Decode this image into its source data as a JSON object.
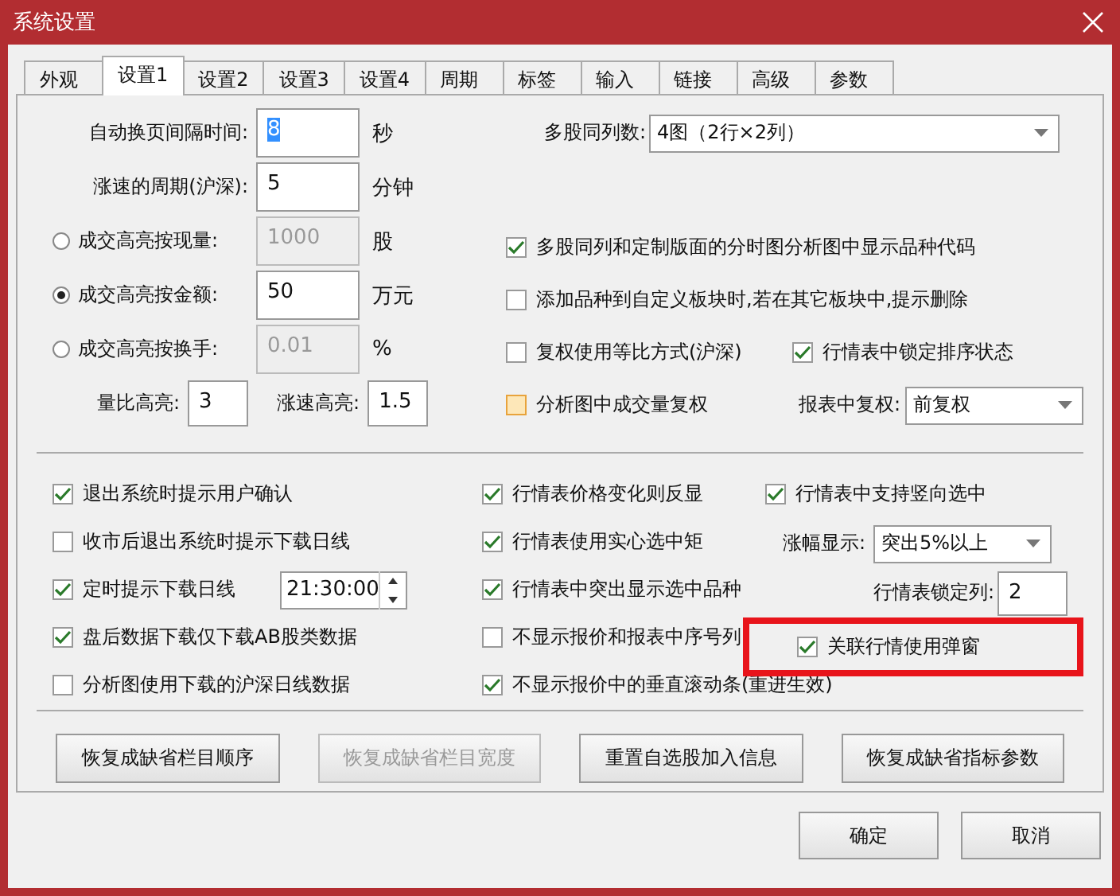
{
  "window": {
    "title": "系统设置"
  },
  "tabs": [
    {
      "label": "外观",
      "selected": false
    },
    {
      "label": "设置1",
      "selected": true
    },
    {
      "label": "设置2",
      "selected": false
    },
    {
      "label": "设置3",
      "selected": false
    },
    {
      "label": "设置4",
      "selected": false
    },
    {
      "label": "周期",
      "selected": false
    },
    {
      "label": "标签",
      "selected": false
    },
    {
      "label": "输入",
      "selected": false
    },
    {
      "label": "链接",
      "selected": false
    },
    {
      "label": "高级",
      "selected": false
    },
    {
      "label": "参数",
      "selected": false
    }
  ],
  "left_fields": [
    {
      "kind": "field",
      "label": "自动换页间隔时间:",
      "value": "8",
      "unit": "秒",
      "disabled": false,
      "focused": true
    },
    {
      "kind": "field",
      "label": "涨速的周期(沪深):",
      "value": "5",
      "unit": "分钟",
      "disabled": false,
      "focused": false
    },
    {
      "kind": "radio",
      "label": "成交高亮按现量:",
      "selected": false,
      "value": "1000",
      "unit": "股",
      "disabled": true,
      "focused": false
    },
    {
      "kind": "radio",
      "label": "成交高亮按金额:",
      "selected": true,
      "value": "50",
      "unit": "万元",
      "disabled": false,
      "focused": false
    },
    {
      "kind": "radio",
      "label": "成交高亮按换手:",
      "selected": false,
      "value": "0.01",
      "unit": "%",
      "disabled": true,
      "focused": false
    }
  ],
  "highlight_pair": [
    {
      "label": "量比高亮:",
      "value": "3"
    },
    {
      "label": "涨速高亮:",
      "value": "1.5"
    }
  ],
  "multi_columns": {
    "label": "多股同列数:",
    "value": "4图（2行×2列）"
  },
  "right_options": [
    [
      {
        "kind": "checkbox",
        "label": "多股同列和定制版面的分时图分析图中显示品种代码",
        "checked": true,
        "hot": false
      }
    ],
    [
      {
        "kind": "checkbox",
        "label": "添加品种到自定义板块时,若在其它板块中,提示删除",
        "checked": false,
        "hot": false
      }
    ],
    [
      {
        "kind": "checkbox",
        "label": "复权使用等比方式(沪深)",
        "checked": false,
        "hot": false
      },
      {
        "kind": "checkbox",
        "label": "行情表中锁定排序状态",
        "checked": true,
        "hot": false
      }
    ],
    [
      {
        "kind": "checkbox",
        "label": "分析图中成交量复权",
        "checked": false,
        "hot": true
      },
      {
        "kind": "select",
        "label": "报表中复权:",
        "value": "前复权"
      }
    ]
  ],
  "option_columns": [
    [
      {
        "kind": "checkbox",
        "label": "退出系统时提示用户确认",
        "checked": true,
        "highlighted": false
      },
      {
        "kind": "checkbox",
        "label": "收市后退出系统时提示下载日线",
        "checked": false,
        "highlighted": false
      },
      {
        "kind": "timed",
        "label": "定时提示下载日线",
        "checked": true,
        "value": "21:30:00",
        "highlighted": false
      },
      {
        "kind": "checkbox",
        "label": "盘后数据下载仅下载AB股类数据",
        "checked": true,
        "highlighted": false
      },
      {
        "kind": "checkbox",
        "label": "分析图使用下载的沪深日线数据",
        "checked": false,
        "highlighted": false
      }
    ],
    [
      {
        "kind": "checkbox",
        "label": "行情表价格变化则反显",
        "checked": true,
        "highlighted": false
      },
      {
        "kind": "checkbox",
        "label": "行情表使用实心选中矩",
        "checked": true,
        "highlighted": false
      },
      {
        "kind": "checkbox",
        "label": "行情表中突出显示选中品种",
        "checked": true,
        "highlighted": false
      },
      {
        "kind": "checkbox",
        "label": "不显示报价和报表中序号列",
        "checked": false,
        "highlighted": false
      },
      {
        "kind": "checkbox",
        "label": "不显示报价中的垂直滚动条(重进生效)",
        "checked": true,
        "highlighted": false
      }
    ],
    [
      {
        "kind": "checkbox",
        "label": "行情表中支持竖向选中",
        "checked": true,
        "highlighted": false
      },
      {
        "kind": "select",
        "label": "涨幅显示:",
        "value": "突出5%以上"
      },
      {
        "kind": "field",
        "label": "行情表锁定列:",
        "value": "2"
      },
      {
        "kind": "checkbox",
        "label": "关联行情使用弹窗",
        "checked": true,
        "highlighted": true
      }
    ]
  ],
  "action_buttons": [
    {
      "label": "恢复成缺省栏目顺序",
      "disabled": false
    },
    {
      "label": "恢复成缺省栏目宽度",
      "disabled": true
    },
    {
      "label": "重置自选股加入信息",
      "disabled": false
    },
    {
      "label": "恢复成缺省指标参数",
      "disabled": false
    }
  ],
  "dialog_buttons": [
    "确定",
    "取消"
  ]
}
